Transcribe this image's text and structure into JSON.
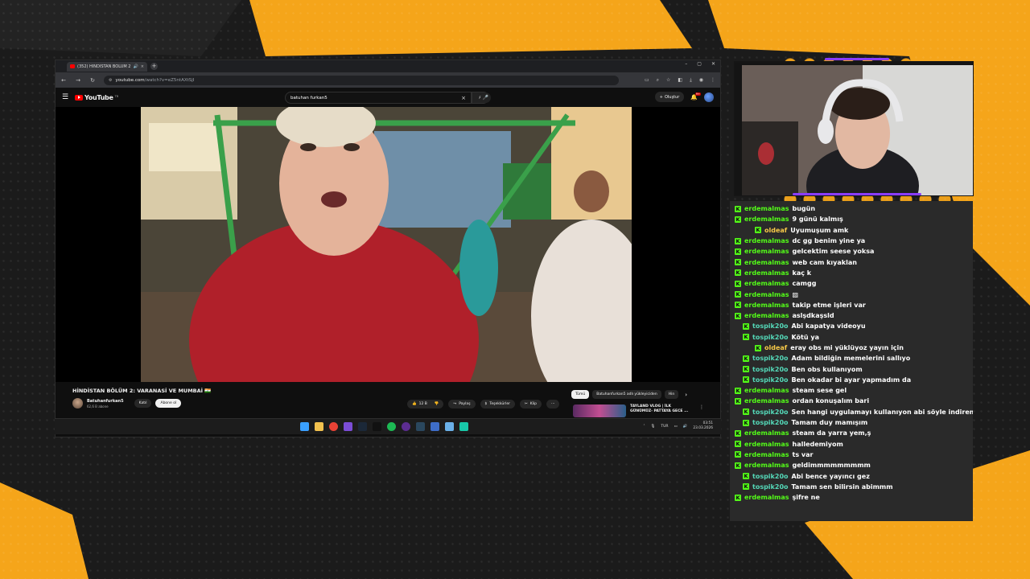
{
  "colors": {
    "overlay_yellow": "#f5a51a",
    "kick_green": "#53fc18",
    "user_teal": "#54d8b8",
    "user_gold": "#f7c948",
    "youtube_red": "#ff0000",
    "cam_purple": "#8a3cff"
  },
  "browser": {
    "tab_title": "(352) HİNDİSTAN BÖLÜM 2",
    "tab_audio_icon": "speaker-icon",
    "tab_close": "×",
    "new_tab": "+",
    "window_controls": [
      "–",
      "▢",
      "✕"
    ],
    "nav": [
      "←",
      "→",
      "↻"
    ],
    "url_domain": "youtube.com",
    "url_path": "/watch?v=eZ5ntAXtSjI",
    "toolbar_icons": [
      "screen-icon",
      "zoom-icon",
      "star-icon",
      "extensions-icon",
      "download-icon",
      "profile-icon",
      "menu-dots-icon"
    ]
  },
  "youtube": {
    "logo_text": "YouTube",
    "logo_region": "TR",
    "search_value": "batuhan furkan5",
    "search_clear": "×",
    "create_label": "Oluştur",
    "notifications_count": "9+",
    "video": {
      "title": "HİNDİSTAN BÖLÜM 2: VARANASİ VE MUMBAİ 🇮🇳",
      "channel": "Batuhanfurkan5",
      "subscribers": "62,6 B abone",
      "join_label": "Katıl",
      "subscribe_label": "Abone ol",
      "likes": "12 B",
      "share_label": "Paylaş",
      "thanks_label": "Teşekkürler",
      "clip_label": "Klip",
      "more_label": "···"
    },
    "chips": [
      "Tümü",
      "Batuhanfurkan5 adlı yükleyiciden",
      "Hin"
    ],
    "recommendation_title": "TAYLAND VLOG | İLK GÜNÜMÜZ- PATTAYA GECE ..."
  },
  "taskbar": {
    "apps": [
      {
        "name": "windows-icon",
        "color": "#3aa0ff"
      },
      {
        "name": "folder-icon",
        "color": "#f2c14e"
      },
      {
        "name": "chrome-icon",
        "color": "#e94235"
      },
      {
        "name": "app-icon",
        "color": "#7b4dd6"
      },
      {
        "name": "steam-icon",
        "color": "#1b2838"
      },
      {
        "name": "capcut-icon",
        "color": "#111111"
      },
      {
        "name": "spotify-icon",
        "color": "#1db954"
      },
      {
        "name": "obs-icon",
        "color": "#5c2d91"
      },
      {
        "name": "steam-icon-2",
        "color": "#2a475e"
      },
      {
        "name": "app-icon-2",
        "color": "#3e6dc8"
      },
      {
        "name": "app-icon-3",
        "color": "#6ab0e8"
      },
      {
        "name": "app-icon-4",
        "color": "#18c8a8"
      }
    ],
    "lang": "TUR",
    "time": "03:51",
    "date": "23.03.2026"
  },
  "chat": {
    "messages": [
      {
        "user": "erdemalmas",
        "text": "bugün",
        "color": "green",
        "indent": 0
      },
      {
        "user": "erdemalmas",
        "text": "9 günü kalmış",
        "color": "green",
        "indent": 0
      },
      {
        "user": "oldeaf",
        "text": "Uyumuşum amk",
        "color": "gold",
        "indent": 2
      },
      {
        "user": "erdemalmas",
        "text": "dc gg benim yine ya",
        "color": "green",
        "indent": 0
      },
      {
        "user": "erdemalmas",
        "text": "gelcektim seese yoksa",
        "color": "green",
        "indent": 0
      },
      {
        "user": "erdemalmas",
        "text": "web cam kıyaklan",
        "color": "green",
        "indent": 0
      },
      {
        "user": "erdemalmas",
        "text": "kaç k",
        "color": "green",
        "indent": 0
      },
      {
        "user": "erdemalmas",
        "text": "camgg",
        "color": "green",
        "indent": 0
      },
      {
        "user": "erdemalmas",
        "text": "▨",
        "color": "green",
        "indent": 0
      },
      {
        "user": "erdemalmas",
        "text": "takip etme işleri var",
        "color": "green",
        "indent": 0
      },
      {
        "user": "erdemalmas",
        "text": "aslşdkaşsld",
        "color": "green",
        "indent": 0
      },
      {
        "user": "tospik20o",
        "text": "Abi kapatya videoyu",
        "color": "teal",
        "indent": 1
      },
      {
        "user": "tospik20o",
        "text": "Kötü ya",
        "color": "teal",
        "indent": 1
      },
      {
        "user": "oldeaf",
        "text": "eray obs mi yüklüyoz yayın için",
        "color": "gold",
        "indent": 2
      },
      {
        "user": "tospik20o",
        "text": "Adam bildiğin memelerini sallıyo",
        "color": "teal",
        "indent": 1
      },
      {
        "user": "tospik20o",
        "text": "Ben obs kullanıyom",
        "color": "teal",
        "indent": 1
      },
      {
        "user": "tospik20o",
        "text": "Ben okadar bi ayar yapmadım da",
        "color": "teal",
        "indent": 1
      },
      {
        "user": "erdemalmas",
        "text": "steam sese gel",
        "color": "green",
        "indent": 0
      },
      {
        "user": "erdemalmas",
        "text": "ordan konuşalım bari",
        "color": "green",
        "indent": 0
      },
      {
        "user": "tospik20o",
        "text": "Sen hangi uygulamayı kullanıyon abi söyle indirem",
        "color": "teal",
        "indent": 1
      },
      {
        "user": "tospik20o",
        "text": "Tamam duy mamışım",
        "color": "teal",
        "indent": 1
      },
      {
        "user": "erdemalmas",
        "text": "steam da yarra yem,ş",
        "color": "green",
        "indent": 0
      },
      {
        "user": "erdemalmas",
        "text": "halledemiyom",
        "color": "green",
        "indent": 0
      },
      {
        "user": "erdemalmas",
        "text": "ts var",
        "color": "green",
        "indent": 0
      },
      {
        "user": "erdemalmas",
        "text": "geldimmmmmmmmm",
        "color": "green",
        "indent": 0
      },
      {
        "user": "tospik20o",
        "text": "Abi bence yayıncı gez",
        "color": "teal",
        "indent": 1
      },
      {
        "user": "tospik20o",
        "text": "Tamam sen bilirsin abimmm",
        "color": "teal",
        "indent": 1
      },
      {
        "user": "erdemalmas",
        "text": "şifre ne",
        "color": "green",
        "indent": 0
      }
    ]
  }
}
